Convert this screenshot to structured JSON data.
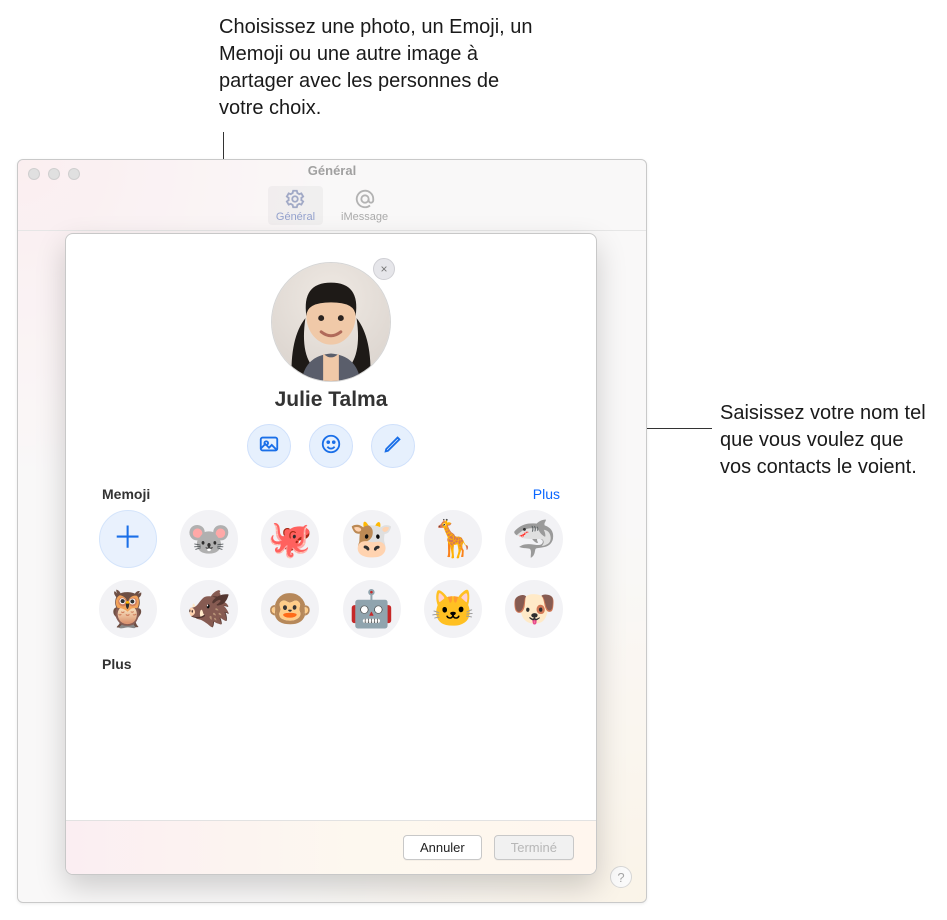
{
  "callouts": {
    "top": "Choisissez une photo, un Emoji, un Memoji ou une autre image à partager avec les personnes de votre choix.",
    "right": "Saisissez votre nom tel que vous voulez que vos contacts le voient."
  },
  "window": {
    "title": "Général",
    "tabs": [
      {
        "label": "Général",
        "icon": "gear-icon",
        "active": true
      },
      {
        "label": "iMessage",
        "icon": "at-icon",
        "active": false
      }
    ]
  },
  "sheet": {
    "user_name": "Julie Talma",
    "avatar_remove_glyph": "×",
    "action_buttons": [
      {
        "name": "photo-picker-button",
        "icon": "photo-icon"
      },
      {
        "name": "emoji-picker-button",
        "icon": "smiley-icon"
      },
      {
        "name": "edit-button",
        "icon": "pencil-icon"
      }
    ],
    "memoji": {
      "heading": "Memoji",
      "more_label": "Plus",
      "items": [
        {
          "name": "add-memoji",
          "glyph": "＋",
          "is_add": true
        },
        {
          "name": "memoji-mouse",
          "glyph": "🐭"
        },
        {
          "name": "memoji-octopus",
          "glyph": "🐙"
        },
        {
          "name": "memoji-cow",
          "glyph": "🐮"
        },
        {
          "name": "memoji-giraffe",
          "glyph": "🦒"
        },
        {
          "name": "memoji-shark",
          "glyph": "🦈"
        },
        {
          "name": "memoji-owl",
          "glyph": "🦉"
        },
        {
          "name": "memoji-boar",
          "glyph": "🐗"
        },
        {
          "name": "memoji-monkey",
          "glyph": "🐵"
        },
        {
          "name": "memoji-robot",
          "glyph": "🤖"
        },
        {
          "name": "memoji-cat",
          "glyph": "🐱"
        },
        {
          "name": "memoji-dog",
          "glyph": "🐶"
        }
      ]
    },
    "plus_section_heading": "Plus",
    "footer": {
      "cancel": "Annuler",
      "done": "Terminé"
    }
  },
  "help_glyph": "?"
}
